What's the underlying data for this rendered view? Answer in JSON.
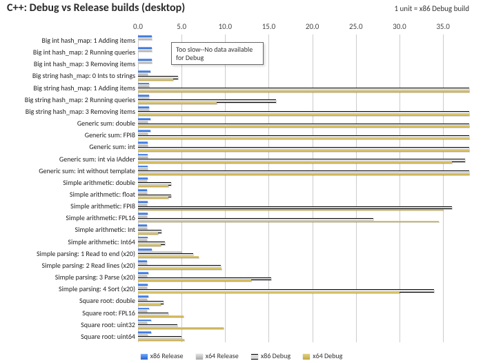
{
  "chart_data": {
    "type": "bar",
    "orientation": "horizontal",
    "title": "C++: Debug vs Release builds (desktop)",
    "subtitle": "1 unit = x86 Debug build",
    "xlabel": "",
    "ylabel": "",
    "xlim": [
      0,
      38
    ],
    "xticks": [
      0.0,
      5.0,
      10.0,
      15.0,
      20.0,
      25.0,
      30.0,
      35.0
    ],
    "series": [
      {
        "name": "x86 Release",
        "color": "#3565c6"
      },
      {
        "name": "x64 Release",
        "color": "#bdbdbd"
      },
      {
        "name": "x86 Debug",
        "color": "#d6d6d6_blackborder"
      },
      {
        "name": "x64 Debug",
        "color": "#c8b35e"
      }
    ],
    "categories": [
      "Big int hash_map: 1 Adding items",
      "Big int hash_map: 2 Running queries",
      "Big int hash_map: 3 Removing items",
      "Big string hash_map: 0 Ints to strings",
      "Big string hash_map: 1 Adding items",
      "Big string hash_map: 2 Running queries",
      "Big string hash_map: 3 Removing items",
      "Generic sum: double",
      "Generic sum: FPI8",
      "Generic sum: int",
      "Generic sum: int via IAdder",
      "Generic sum: int without template",
      "Simple arithmetic: double",
      "Simple arithmetic: float",
      "Simple arithmetic: FPI8",
      "Simple arithmetic: FPL16",
      "Simple arithmetic: Int",
      "Simple arithmetic: Int64",
      "Simple parsing: 1 Read to end (x20)",
      "Simple parsing: 2 Read lines (x20)",
      "Simple parsing: 3 Parse (x20)",
      "Simple parsing: 4 Sort (x20)",
      "Square root: double",
      "Square root: FPL16",
      "Square root: uint32",
      "Square root: uint64"
    ],
    "note_null": "null = value off-scale / not available (no bar drawn)",
    "values": {
      "x86 Release": [
        1.6,
        1.6,
        1.6,
        1.4,
        1.3,
        1.3,
        1.3,
        1.4,
        1.4,
        1.1,
        1.1,
        1.1,
        1.1,
        1.0,
        1.1,
        1.1,
        1.0,
        1.1,
        1.6,
        1.0,
        1.2,
        1.1,
        1.2,
        1.3,
        1.5,
        1.5
      ],
      "x64 Release": [
        1.6,
        1.6,
        1.6,
        1.1,
        1.3,
        1.3,
        1.3,
        1.1,
        1.1,
        1.1,
        1.1,
        1.1,
        1.0,
        1.0,
        1.0,
        1.0,
        1.0,
        1.0,
        5.0,
        1.0,
        1.0,
        1.0,
        1.0,
        1.0,
        1.0,
        1.1
      ],
      "x86 Debug": [
        null,
        null,
        null,
        4.6,
        51,
        15.8,
        51,
        51,
        51,
        51,
        37.5,
        51,
        3.8,
        3.8,
        36.0,
        27.0,
        2.7,
        3.1,
        6.3,
        9.5,
        15.3,
        34.0,
        2.9,
        3.5,
        4.5,
        5.0
      ],
      "x64 Debug": [
        null,
        null,
        null,
        4.0,
        51,
        9.0,
        51,
        51,
        51,
        51,
        36.0,
        51,
        3.5,
        3.5,
        35.0,
        34.5,
        2.3,
        2.6,
        7.0,
        9.6,
        13.0,
        30.0,
        2.6,
        5.2,
        9.8,
        5.3
      ]
    },
    "annotation": {
      "text": "Too slow--No data available for Debug",
      "applies_to_categories": [
        0,
        1,
        2
      ]
    }
  },
  "legend_labels": [
    "x86 Release",
    "x64 Release",
    "x86 Debug",
    "x64 Debug"
  ],
  "callout_text": "Too slow--No data available for Debug"
}
